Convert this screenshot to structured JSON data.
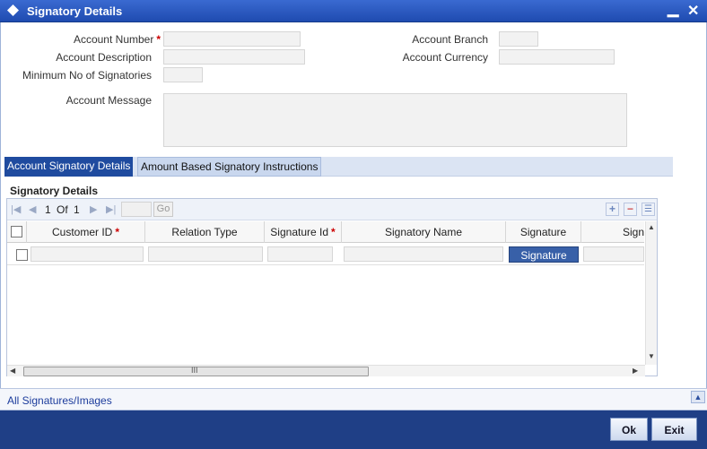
{
  "window": {
    "title": "Signatory Details",
    "minimize": "▁",
    "close": "✕"
  },
  "form": {
    "account_number_label": "Account Number",
    "account_branch_label": "Account Branch",
    "account_description_label": "Account Description",
    "account_currency_label": "Account Currency",
    "min_signatories_label": "Minimum No of Signatories",
    "account_message_label": "Account Message",
    "required_mark": "*"
  },
  "tabs": [
    {
      "label": "Account Signatory Details",
      "active": true
    },
    {
      "label": "Amount Based Signatory Instructions",
      "active": false
    }
  ],
  "grid": {
    "section_title": "Signatory Details",
    "pager": {
      "current": "1",
      "of_label": "Of",
      "total": "1",
      "go_label": "Go"
    },
    "columns": [
      "Customer ID",
      "Relation Type",
      "Signature Id",
      "Signatory Name",
      "Signature",
      "Sign"
    ],
    "row_button_label": "Signature",
    "scroll_grip": "III"
  },
  "bottom": {
    "link_label": "All Signatures/Images"
  },
  "buttons": {
    "ok_label": "Ok",
    "exit_label": "Exit"
  },
  "colors": {
    "header_blue": "#1f4bb0",
    "footer_blue": "#1f3f86",
    "required_red": "#cc0000"
  }
}
